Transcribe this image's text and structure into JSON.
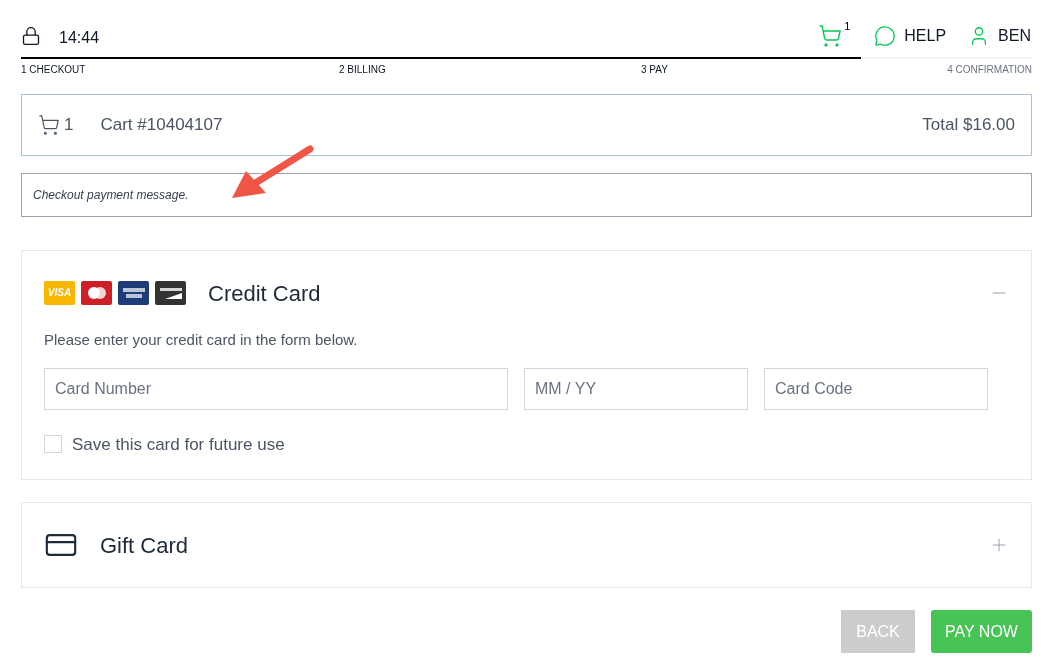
{
  "header": {
    "time": "14:44",
    "cart_count": "1",
    "help": "HELP",
    "user": "BEN"
  },
  "progress": {
    "level": 0.831,
    "steps": [
      {
        "label": "1 CHECKOUT",
        "done": true
      },
      {
        "label": "2 BILLING",
        "done": true
      },
      {
        "label": "3 PAY",
        "done": true
      },
      {
        "label": "4 CONFIRMATION",
        "done": false
      }
    ]
  },
  "cart": {
    "count": "1",
    "title": "Cart #10404107",
    "total": "Total $16.00"
  },
  "message": "Checkout payment message.",
  "payment_methods": [
    {
      "kind": "credit",
      "title": "Credit Card",
      "expanded": true,
      "card_logos": [
        {
          "label": "VISA",
          "color": "#f7b600"
        },
        {
          "color": "#cc1f26"
        },
        {
          "color": "#1d3c78"
        },
        {
          "color": "#333333"
        }
      ],
      "instructions": "Please enter your credit card in the form below.",
      "fields": [
        {
          "placeholder": "Card Number"
        },
        {
          "placeholder": "MM / YY"
        },
        {
          "placeholder": "Card Code"
        }
      ],
      "save_card": {
        "label": "Save this card for future use",
        "checked": false
      }
    },
    {
      "kind": "gift",
      "title": "Gift Card",
      "expanded": false
    }
  ],
  "buttons": [
    {
      "label": "BACK",
      "disabled": true
    },
    {
      "label": "PAY NOW",
      "disabled": false
    }
  ]
}
